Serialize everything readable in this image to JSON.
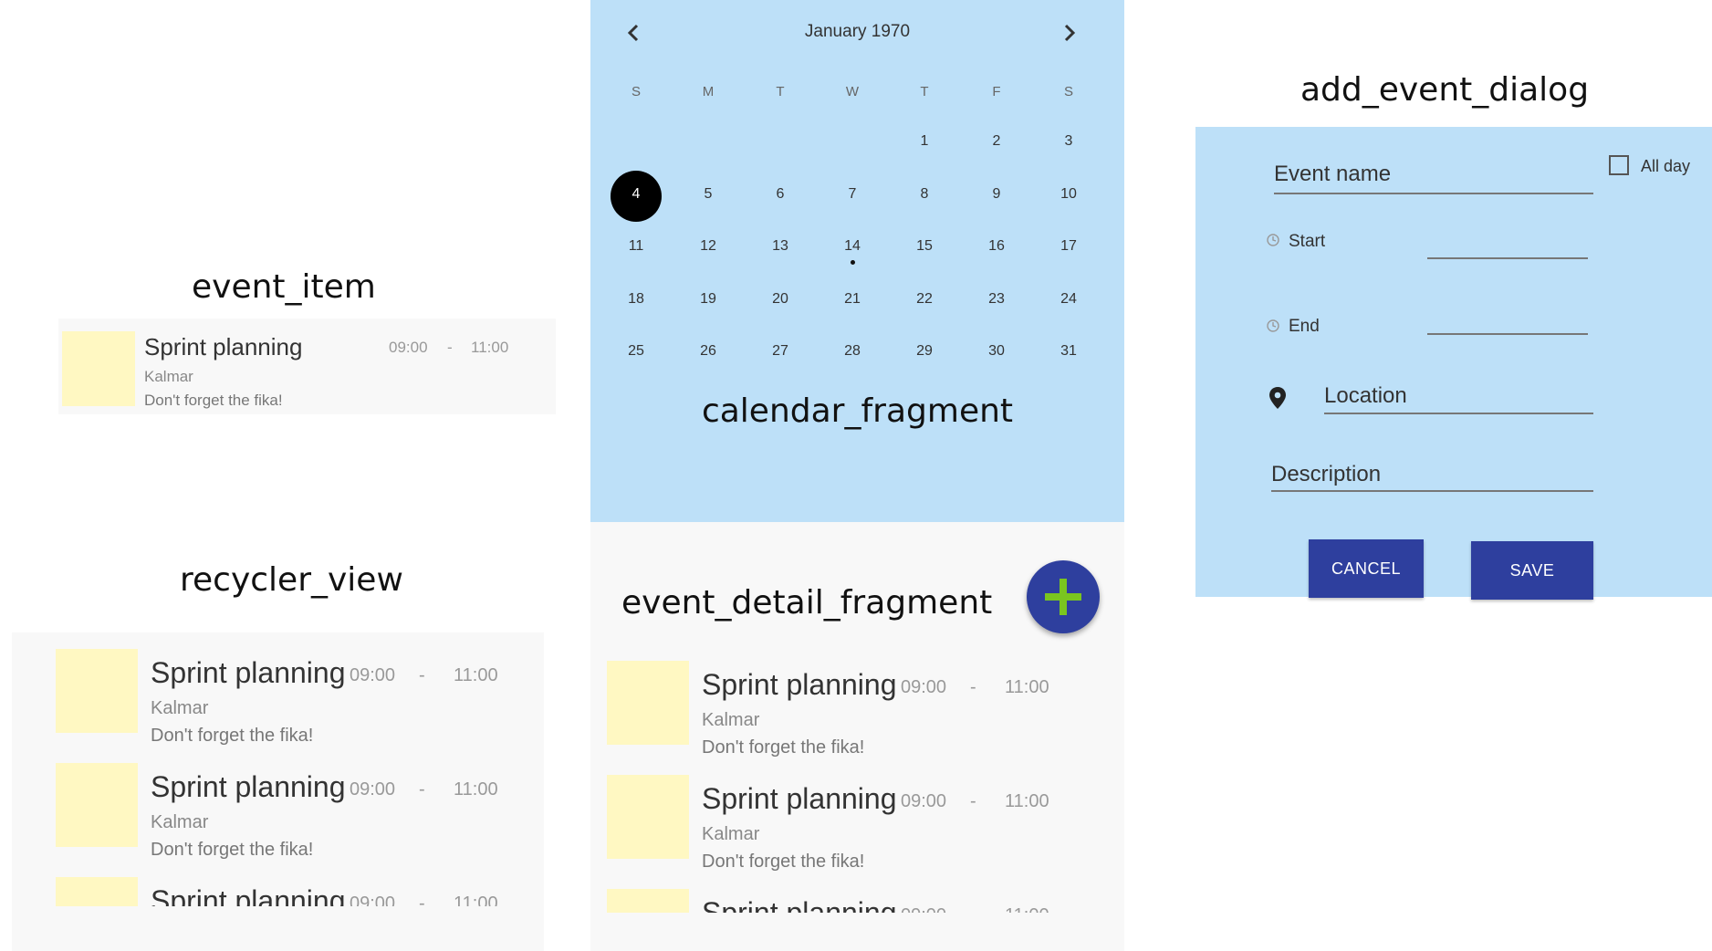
{
  "captions": {
    "event_item": "event_item",
    "recycler_view": "recycler_view",
    "calendar_fragment": "calendar_fragment",
    "event_detail_fragment": "event_detail_fragment",
    "add_event_dialog": "add_event_dialog"
  },
  "event": {
    "title": "Sprint planning",
    "location": "Kalmar",
    "description": "Don't forget the fika!",
    "start": "09:00",
    "dash": "-",
    "end": "11:00"
  },
  "calendar": {
    "month_label": "January 1970",
    "prev_icon": "chevron-left-icon",
    "next_icon": "chevron-right-icon",
    "weekdays": [
      "S",
      "M",
      "T",
      "W",
      "T",
      "F",
      "S"
    ],
    "weeks": [
      [
        "",
        "",
        "",
        "",
        "1",
        "2",
        "3"
      ],
      [
        "4",
        "5",
        "6",
        "7",
        "8",
        "9",
        "10"
      ],
      [
        "11",
        "12",
        "13",
        "14",
        "15",
        "16",
        "17"
      ],
      [
        "18",
        "19",
        "20",
        "21",
        "22",
        "23",
        "24"
      ],
      [
        "25",
        "26",
        "27",
        "28",
        "29",
        "30",
        "31"
      ]
    ],
    "selected_day": "4",
    "event_day": "14"
  },
  "fab": {
    "icon": "plus-icon",
    "accent": "#7ac51f"
  },
  "dialog": {
    "event_name_placeholder": "Event name",
    "all_day_label": "All day",
    "start_label": "Start",
    "end_label": "End",
    "location_placeholder": "Location",
    "description_placeholder": "Description",
    "cancel_label": "CANCEL",
    "save_label": "SAVE"
  },
  "colors": {
    "panel_blue": "#bde0f8",
    "button_navy": "#2e3f9e",
    "thumb_yellow": "#fff8c2",
    "fab_navy": "#2e3f9e"
  }
}
